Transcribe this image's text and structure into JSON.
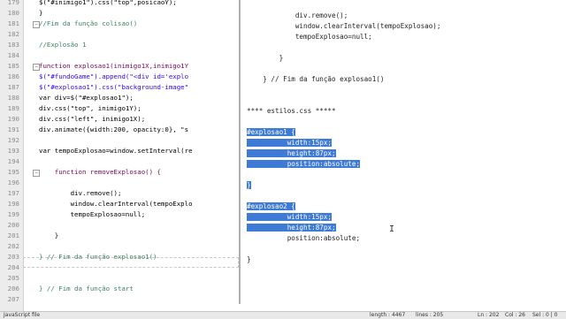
{
  "editor": {
    "lines": [
      {
        "n": "179",
        "code": "$(\"#inimigo1\").css(\"top\",posicaoY);",
        "cls": "df"
      },
      {
        "n": "180",
        "code": "}",
        "cls": "df"
      },
      {
        "n": "181",
        "code": "//Fim da função colisao()",
        "cls": "cm"
      },
      {
        "n": "182",
        "code": "",
        "cls": "df"
      },
      {
        "n": "183",
        "code": "//Explosão 1",
        "cls": "cm"
      },
      {
        "n": "184",
        "code": "",
        "cls": "df"
      },
      {
        "n": "185",
        "code": "function explosao1(inimigo1X,inimigo1Y",
        "cls": "kw"
      },
      {
        "n": "186",
        "code": "$(\"#fundoGame\").append(\"<div id='explo",
        "cls": "str"
      },
      {
        "n": "187",
        "code": "$(\"#explosao1\").css(\"background-image\"",
        "cls": "str"
      },
      {
        "n": "188",
        "code": "var div=$(\"#explosao1\");",
        "cls": "df"
      },
      {
        "n": "189",
        "code": "div.css(\"top\", inimigo1Y);",
        "cls": "df"
      },
      {
        "n": "190",
        "code": "div.css(\"left\", inimigo1X);",
        "cls": "df"
      },
      {
        "n": "191",
        "code": "div.animate({width:200, opacity:0}, \"s",
        "cls": "df"
      },
      {
        "n": "192",
        "code": "",
        "cls": "df"
      },
      {
        "n": "193",
        "code": "var tempoExplosao=window.setInterval(re",
        "cls": "df"
      },
      {
        "n": "194",
        "code": "",
        "cls": "df"
      },
      {
        "n": "195",
        "code": "    function removeExplosao() {",
        "cls": "kw"
      },
      {
        "n": "196",
        "code": "",
        "cls": "df"
      },
      {
        "n": "197",
        "code": "        div.remove();",
        "cls": "df"
      },
      {
        "n": "198",
        "code": "        window.clearInterval(tempoExplo",
        "cls": "df"
      },
      {
        "n": "199",
        "code": "        tempoExplosao=null;",
        "cls": "df"
      },
      {
        "n": "200",
        "code": "",
        "cls": "df"
      },
      {
        "n": "201",
        "code": "    }",
        "cls": "df"
      },
      {
        "n": "202",
        "code": "",
        "cls": "df"
      },
      {
        "n": "203",
        "code": "} // Fim da função explosao1()",
        "cls": "cm"
      },
      {
        "n": "204",
        "code": "",
        "cls": "df"
      },
      {
        "n": "205",
        "code": "",
        "cls": "df"
      },
      {
        "n": "206",
        "code": "} // Fim da função start",
        "cls": "cm"
      },
      {
        "n": "207",
        "code": "",
        "cls": "df"
      }
    ]
  },
  "notes": {
    "lines": [
      {
        "text": "            div.remove();",
        "sel": false
      },
      {
        "text": "            window.clearInterval(tempoExplosao);",
        "sel": false
      },
      {
        "text": "            tempoExplosao=null;",
        "sel": false
      },
      {
        "text": "",
        "sel": false
      },
      {
        "text": "        }",
        "sel": false
      },
      {
        "text": "",
        "sel": false
      },
      {
        "text": "    } // Fim da função explosao1()",
        "sel": false
      },
      {
        "text": "",
        "sel": false
      },
      {
        "text": "",
        "sel": false
      },
      {
        "text": "**** estilos.css *****",
        "sel": false
      },
      {
        "text": "",
        "sel": false
      },
      {
        "text": "#explosao1 {",
        "sel": true
      },
      {
        "text": "          width:15px;",
        "sel": true
      },
      {
        "text": "          height:87px;",
        "sel": true
      },
      {
        "text": "          position:absolute;",
        "sel": true
      },
      {
        "text": "",
        "sel": false
      },
      {
        "text": "}",
        "sel": true
      },
      {
        "text": "",
        "sel": false
      },
      {
        "text": "#explosao2 {",
        "sel": true
      },
      {
        "text": "          width:15px;",
        "sel": true
      },
      {
        "text": "          height:87px;",
        "sel": true
      },
      {
        "text": "          position:absolute;",
        "sel": false
      },
      {
        "text": "",
        "sel": false
      },
      {
        "text": "}",
        "sel": false
      }
    ]
  },
  "status": {
    "file_type": "JavaScript file",
    "length": "length : 4467",
    "lines": "lines : 205",
    "ln": "Ln : 202",
    "col": "Col : 26",
    "sel": "Sel : 0 | 0"
  }
}
